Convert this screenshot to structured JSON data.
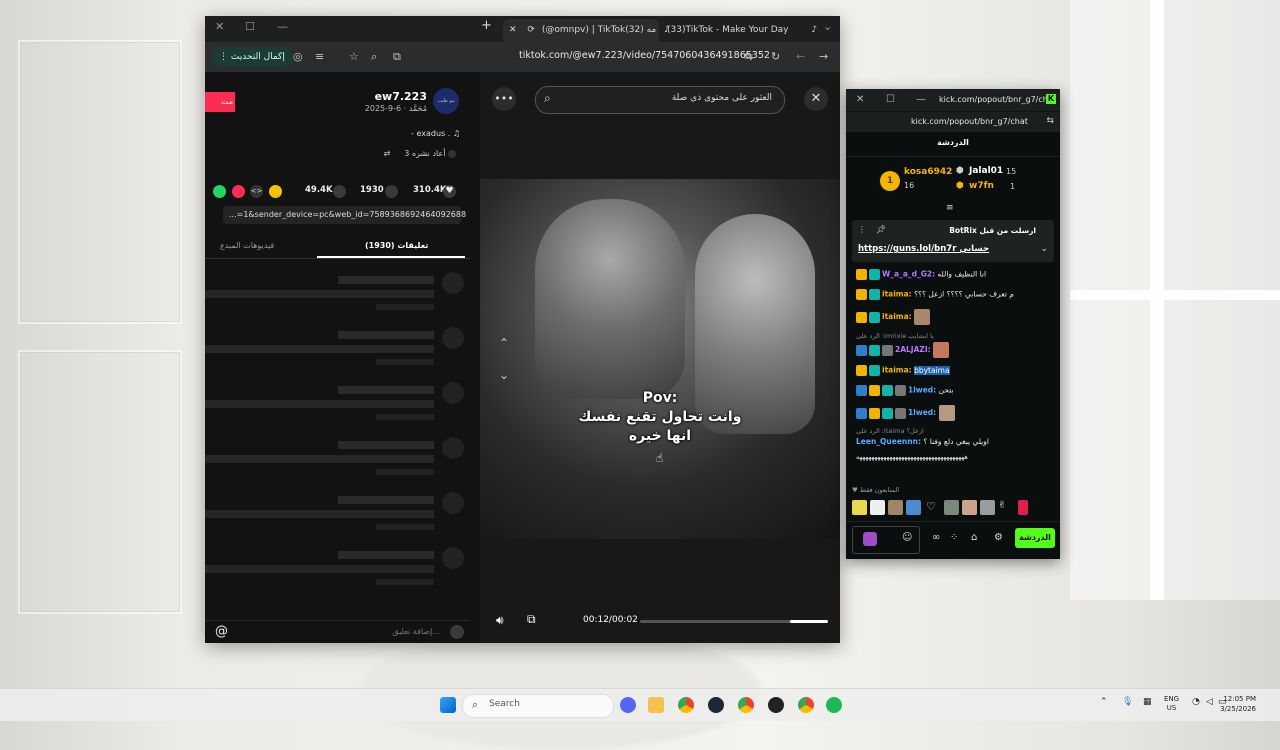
{
  "browser": {
    "tabs": [
      {
        "label": "(@omnpv) | TikTok(32) مه"
      },
      {
        "label": "(33)TikTok - Make Your Day"
      }
    ],
    "update_label": "إكمال التحديث",
    "url": "tiktok.com/@ew7.223/video/7547060436491865352"
  },
  "tiktok": {
    "search_query": "العثور على محتوى ذي صلة",
    "username": "ew7.223",
    "date": "2025-9-6 · مُحَمَّد",
    "follow_label": "مت",
    "music": "- exadus .",
    "reposts": "3 أعاد نشره",
    "avatar_text": "مو طيب",
    "stats": {
      "likes": "310.4K",
      "comments": "1930",
      "saves": "49.4K"
    },
    "link_text": "...=1&sender_device=pc&web_id=7589368692464092688",
    "tab_comments": "تعليقات (1930)",
    "tab_creator_videos": "فيديوهات المبدع",
    "comment_placeholder": "إضافة تعليق...",
    "video_caption": [
      "Pov:",
      "وانت تحاول تقنع نفسك",
      "انها خيره"
    ],
    "time": "00:12/00:02",
    "progress": 0.2
  },
  "kick": {
    "window_title": "kick.com/popout/bnr_g7/ch...",
    "url": "kick.com/popout/bnr_g7/chat",
    "header": "الدردشة",
    "gifters": [
      {
        "name": "kosa6942",
        "count": "16",
        "color": "#f5b400"
      },
      {
        "name": "Jalal01",
        "count": "15",
        "color": "#fff"
      },
      {
        "name": "w7fn",
        "count": "1",
        "color": "#f5b400"
      }
    ],
    "rank": "1",
    "pinned_title": "BotRix ارسلت من قبل",
    "pinned_link": "https://guns.lol/bn7r حسابي",
    "messages": [
      {
        "nick": "W_a_a_d_G2:",
        "text": "انا النظيف والله",
        "color": "#b37bff"
      },
      {
        "nick": "itaima:",
        "text": "م تعرف حسابي ؟؟؟؟ ازعل ؟؟؟",
        "color": "#f5b400"
      },
      {
        "nick": "itaima:",
        "text": "",
        "color": "#f5b400"
      },
      {
        "nick": "2ALJAZI:",
        "text": "",
        "color": "#b37bff"
      },
      {
        "nick": "itaima:",
        "text": "bbytaima",
        "color": "#f5b400"
      },
      {
        "nick": "1lwed:",
        "text": "بتحن",
        "color": "#5fa8ff"
      },
      {
        "nick": "1lwed:",
        "text": "",
        "color": "#5fa8ff"
      },
      {
        "nick": "Leen_Queennn:",
        "text": "اويلي يبغي دلع وفنا ؟",
        "color": "#5fa8ff"
      },
      {
        "nick": "",
        "text": "ههههههههههههههههههههههههههههههههههههه",
        "color": "#fff"
      }
    ],
    "replies": [
      "الرد على :imrixie يا ابشايب",
      "الرد على :itaima ازعل؟"
    ],
    "followers_only": "المتابعون فقط",
    "chat_button": "الدردشة"
  },
  "taskbar": {
    "search": "Search",
    "lang1": "ENG",
    "lang2": "US",
    "time": "12:05 PM",
    "date": "3/25/2026"
  }
}
